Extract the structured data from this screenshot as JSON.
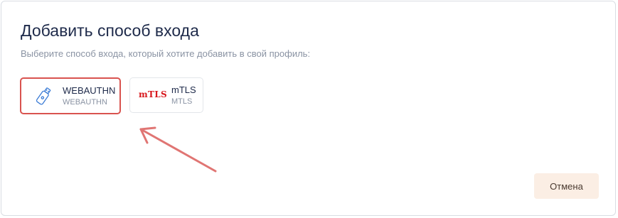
{
  "dialog": {
    "title": "Добавить способ входа",
    "subtitle": "Выберите способ входа, который хотите добавить в свой профиль:"
  },
  "methods": [
    {
      "name": "WEBAUTHN",
      "type": "WEBAUTHN",
      "icon": "usb-key-icon",
      "selected": true
    },
    {
      "name": "mTLS",
      "type": "MTLS",
      "icon": "mtls-logo-icon",
      "icon_text": "mTLS",
      "selected": false
    }
  ],
  "footer": {
    "cancel_label": "Отмена"
  },
  "colors": {
    "title": "#1e2a4a",
    "muted": "#8a93a3",
    "highlight_border": "#d9534f",
    "annotation_arrow": "#e07573",
    "cancel_bg": "#fbeee4",
    "mtls_logo": "#d8181d"
  }
}
